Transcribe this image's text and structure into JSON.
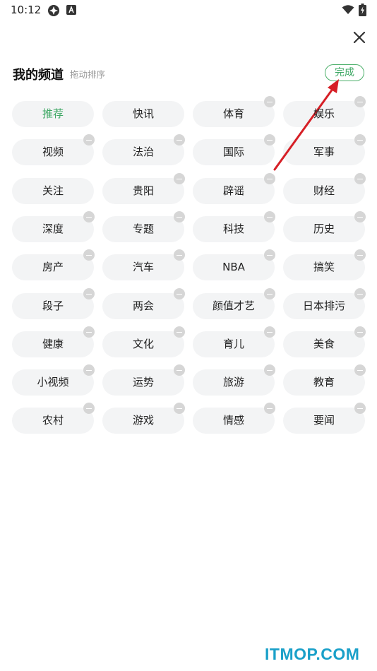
{
  "status_bar": {
    "time": "10:12"
  },
  "header": {
    "title": "我的频道",
    "hint": "拖动排序",
    "done_label": "完成"
  },
  "channels": [
    {
      "label": "推荐",
      "active": true,
      "removable": false
    },
    {
      "label": "快讯",
      "active": false,
      "removable": false
    },
    {
      "label": "体育",
      "active": false,
      "removable": true
    },
    {
      "label": "娱乐",
      "active": false,
      "removable": true
    },
    {
      "label": "视频",
      "active": false,
      "removable": true
    },
    {
      "label": "法治",
      "active": false,
      "removable": true
    },
    {
      "label": "国际",
      "active": false,
      "removable": true
    },
    {
      "label": "军事",
      "active": false,
      "removable": true
    },
    {
      "label": "关注",
      "active": false,
      "removable": false
    },
    {
      "label": "贵阳",
      "active": false,
      "removable": true
    },
    {
      "label": "辟谣",
      "active": false,
      "removable": true
    },
    {
      "label": "财经",
      "active": false,
      "removable": true
    },
    {
      "label": "深度",
      "active": false,
      "removable": true
    },
    {
      "label": "专题",
      "active": false,
      "removable": true
    },
    {
      "label": "科技",
      "active": false,
      "removable": true
    },
    {
      "label": "历史",
      "active": false,
      "removable": true
    },
    {
      "label": "房产",
      "active": false,
      "removable": true
    },
    {
      "label": "汽车",
      "active": false,
      "removable": true
    },
    {
      "label": "NBA",
      "active": false,
      "removable": true
    },
    {
      "label": "搞笑",
      "active": false,
      "removable": true
    },
    {
      "label": "段子",
      "active": false,
      "removable": true
    },
    {
      "label": "两会",
      "active": false,
      "removable": true
    },
    {
      "label": "颜值才艺",
      "active": false,
      "removable": true
    },
    {
      "label": "日本排污",
      "active": false,
      "removable": true
    },
    {
      "label": "健康",
      "active": false,
      "removable": true
    },
    {
      "label": "文化",
      "active": false,
      "removable": true
    },
    {
      "label": "育儿",
      "active": false,
      "removable": true
    },
    {
      "label": "美食",
      "active": false,
      "removable": true
    },
    {
      "label": "小视频",
      "active": false,
      "removable": true
    },
    {
      "label": "运势",
      "active": false,
      "removable": true
    },
    {
      "label": "旅游",
      "active": false,
      "removable": true
    },
    {
      "label": "教育",
      "active": false,
      "removable": true
    },
    {
      "label": "农村",
      "active": false,
      "removable": true
    },
    {
      "label": "游戏",
      "active": false,
      "removable": true
    },
    {
      "label": "情感",
      "active": false,
      "removable": true
    },
    {
      "label": "要闻",
      "active": false,
      "removable": true
    }
  ],
  "watermark": "ITMOP.COM",
  "colors": {
    "accent_green": "#3fa865",
    "chip_background": "#f3f4f5",
    "remove_badge": "#d6d6d6",
    "annotation_arrow": "#d61f26",
    "watermark": "#1aa0c9"
  },
  "icons": {
    "status": [
      "compass-icon",
      "text-a-icon",
      "wifi-icon",
      "battery-icon"
    ],
    "close": "close-icon",
    "remove": "minus-circle-icon"
  }
}
